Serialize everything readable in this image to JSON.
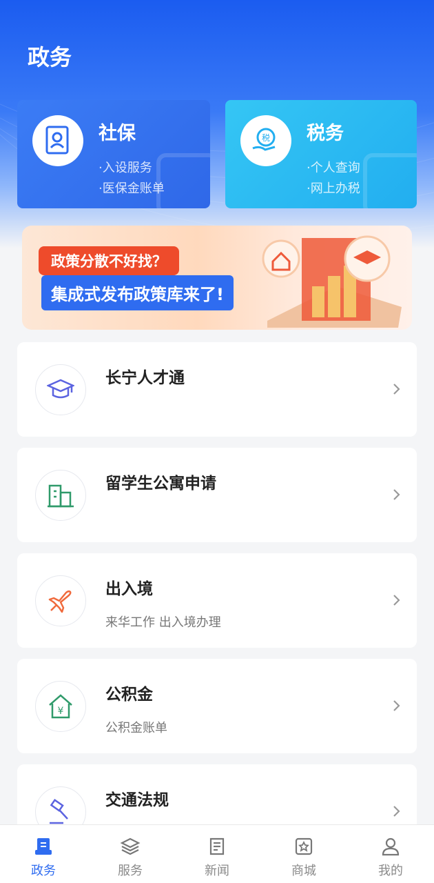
{
  "page": {
    "title": "政务"
  },
  "top_cards": [
    {
      "title": "社保",
      "lines": [
        "·入设服务",
        "·医保金账单"
      ],
      "icon": "document-icon"
    },
    {
      "title": "税务",
      "lines": [
        "·个人查询",
        "·网上办税"
      ],
      "icon": "tax-hand-icon",
      "icon_text": "税"
    }
  ],
  "banner": {
    "line1": "政策分散不好找？",
    "line2": "集成式发布政策库来了!"
  },
  "list": [
    {
      "title": "长宁人才通",
      "subtitle": "",
      "icon": "graduation-cap-icon",
      "icon_color": "#5b63e0"
    },
    {
      "title": "留学生公寓申请",
      "subtitle": "",
      "icon": "building-icon",
      "icon_color": "#2f9a6a"
    },
    {
      "title": "出入境",
      "subtitle": "来华工作 出入境办理",
      "icon": "airplane-icon",
      "icon_color": "#f06a3c"
    },
    {
      "title": "公积金",
      "subtitle": "公积金账单",
      "icon": "house-yuan-icon",
      "icon_color": "#2f9a6a"
    },
    {
      "title": "交通法规",
      "subtitle": "",
      "icon": "gavel-icon",
      "icon_color": "#5b63e0"
    }
  ],
  "tabbar": [
    {
      "label": "政务",
      "icon": "gov-icon",
      "active": true
    },
    {
      "label": "服务",
      "icon": "layers-icon",
      "active": false
    },
    {
      "label": "新闻",
      "icon": "news-icon",
      "active": false
    },
    {
      "label": "商城",
      "icon": "mall-icon",
      "active": false
    },
    {
      "label": "我的",
      "icon": "user-icon",
      "active": false
    }
  ],
  "colors": {
    "primary": "#2f6cf0",
    "tax": "#22aef0",
    "text": "#222222",
    "muted": "#777777"
  }
}
